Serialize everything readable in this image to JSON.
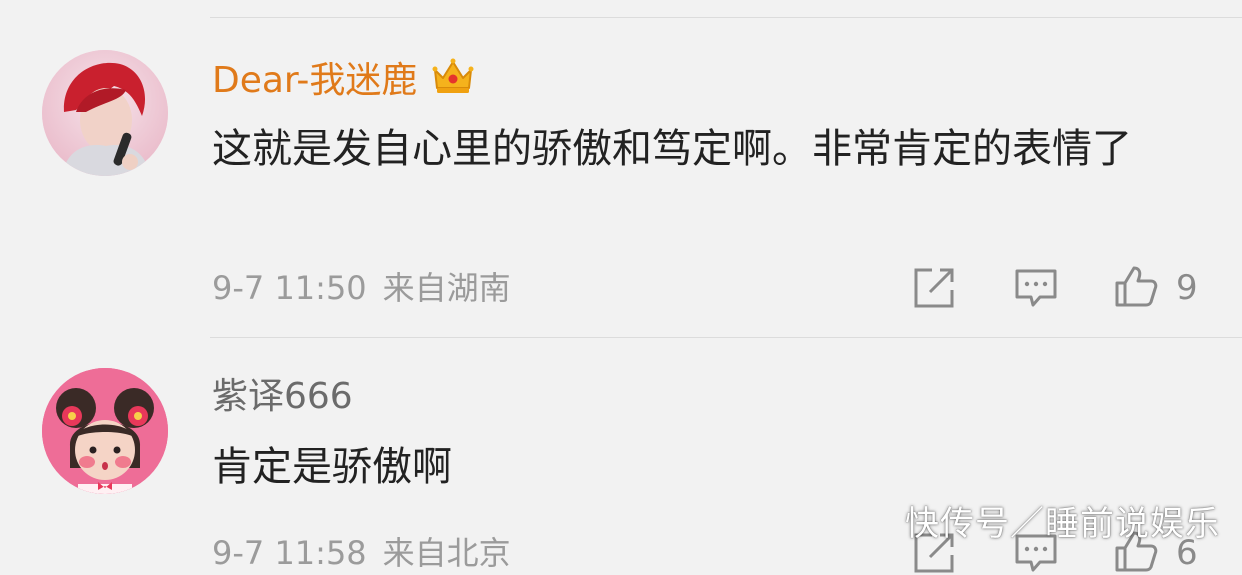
{
  "comments": [
    {
      "username": "Dear-我迷鹿",
      "username_color": "#e07a1a",
      "badge_icon": "crown-icon",
      "text": "这就是发自心里的骄傲和笃定啊。非常肯定的表情了",
      "time": "9-7 11:50",
      "location": "来自湖南",
      "likes": "9"
    },
    {
      "username": "紫译666",
      "username_color": "#6b6b6b",
      "text": "肯定是骄傲啊",
      "time": "9-7 11:58",
      "location": "来自北京",
      "likes": "6"
    }
  ],
  "watermark": "快传号／睡前说娱乐"
}
